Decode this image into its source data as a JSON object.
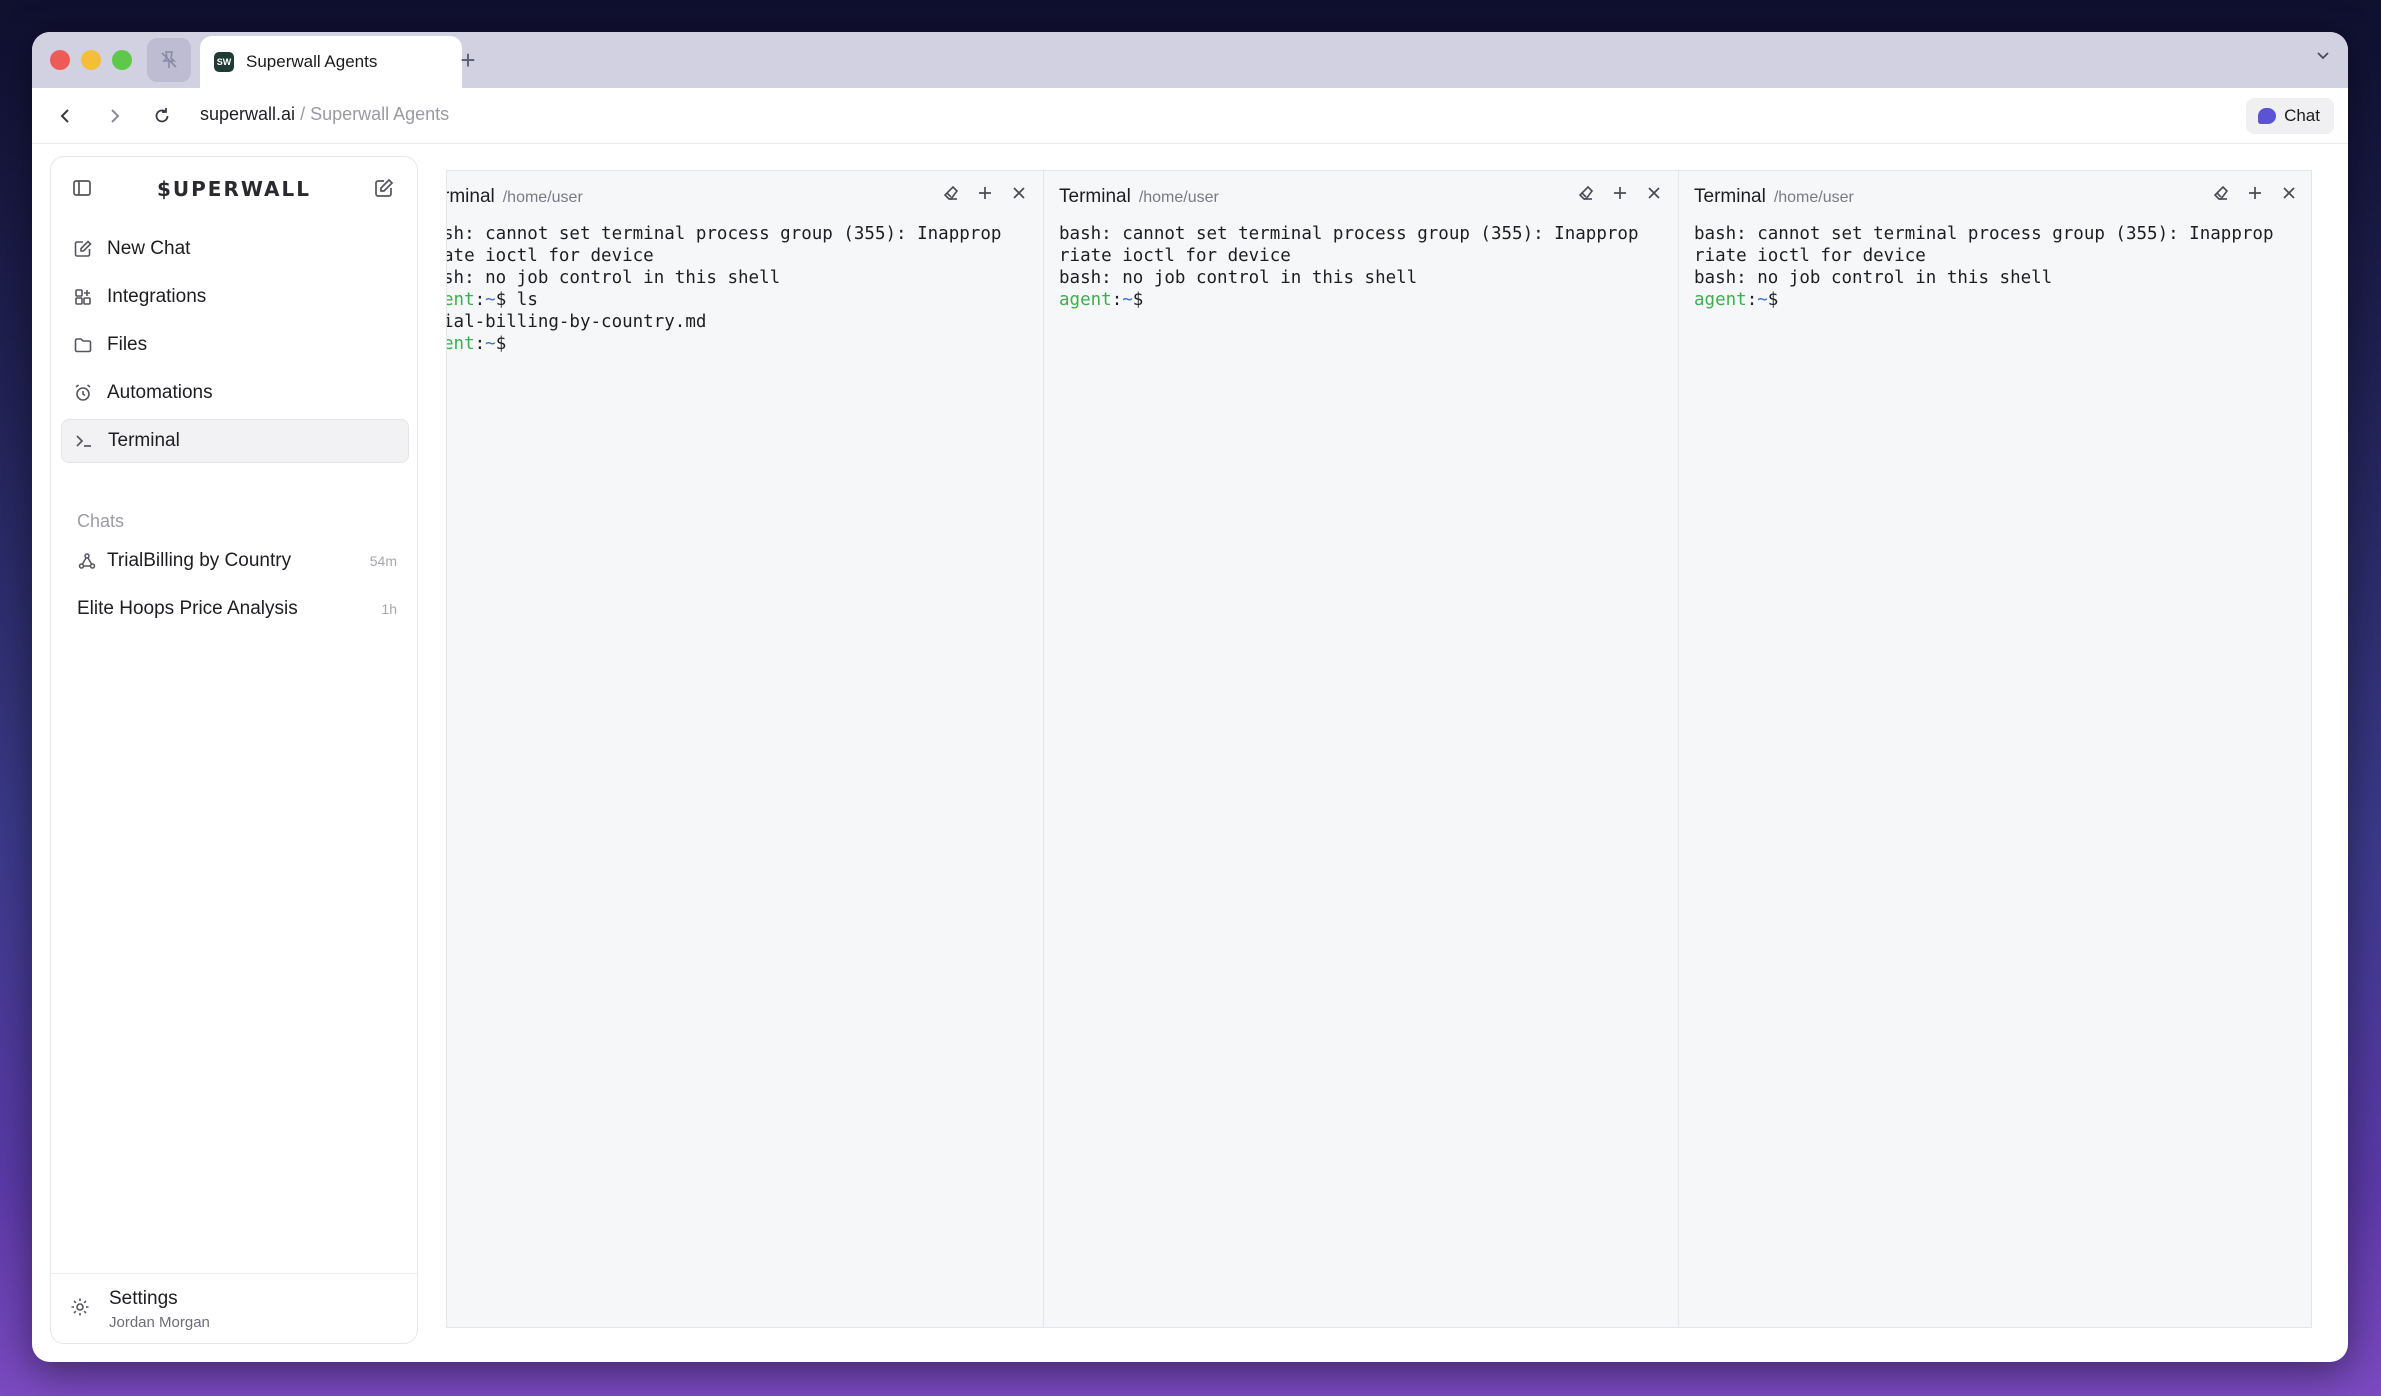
{
  "browser": {
    "tab_title": "Superwall Agents",
    "favicon_text": "SW",
    "url_domain": "superwall.ai",
    "url_separator": "/",
    "url_page": "Superwall Agents",
    "chat_button_label": "Chat"
  },
  "sidebar": {
    "logo": "$UPERWALL",
    "nav": [
      {
        "label": "New Chat",
        "icon": "compose-icon"
      },
      {
        "label": "Integrations",
        "icon": "integrations-icon"
      },
      {
        "label": "Files",
        "icon": "folder-icon"
      },
      {
        "label": "Automations",
        "icon": "alarm-clock-icon"
      },
      {
        "label": "Terminal",
        "icon": "terminal-icon",
        "active": true
      }
    ],
    "chats_heading": "Chats",
    "chats": [
      {
        "title": "TrialBilling by Country",
        "age": "54m",
        "icon": "webhook-icon"
      },
      {
        "title": "Elite Hoops Price Analysis",
        "age": "1h"
      }
    ],
    "footer": {
      "settings_label": "Settings",
      "user_name": "Jordan Morgan"
    }
  },
  "terminals": [
    {
      "title": "rminal",
      "path": "/home/user",
      "lines": [
        "sh: cannot set terminal process group (355): Inapprop",
        "ate ioctl for device",
        "sh: no job control in this shell"
      ],
      "prompt1_user": "ent",
      "prompt_sep": ":",
      "prompt_path": "~",
      "prompt_sign": "$",
      "command": " ls",
      "output": "ial-billing-by-country.md",
      "prompt2_user": "ent"
    },
    {
      "title": "Terminal",
      "path": "/home/user",
      "lines": [
        "bash: cannot set terminal process group (355): Inapprop",
        "riate ioctl for device",
        "bash: no job control in this shell"
      ],
      "prompt_user": "agent",
      "prompt_sep": ":",
      "prompt_path": "~",
      "prompt_sign": "$"
    },
    {
      "title": "Terminal",
      "path": "/home/user",
      "lines": [
        "bash: cannot set terminal process group (355): Inapprop",
        "riate ioctl for device",
        "bash: no job control in this shell"
      ],
      "prompt_user": "agent",
      "prompt_sep": ":",
      "prompt_path": "~",
      "prompt_sign": "$"
    }
  ],
  "colors": {
    "prompt_user": "#3fae4f",
    "prompt_path": "#3a6fd0",
    "accent": "#5b52d6"
  }
}
